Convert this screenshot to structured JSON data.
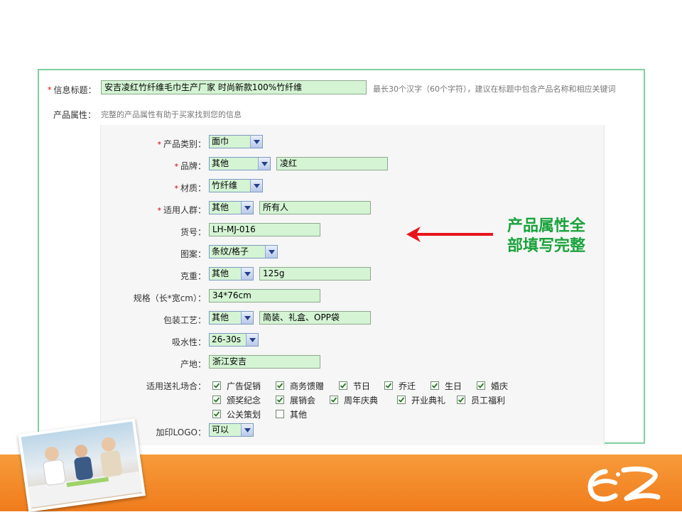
{
  "title_row": {
    "label": "信息标题：",
    "value": "安吉凌红竹纤维毛巾生产厂家 时尚新款100%竹纤维",
    "hint": "最长30个汉字（60个字符），建议在标题中包含产品名称和相应关键词"
  },
  "attr_row": {
    "label": "产品属性：",
    "hint": "完整的产品属性有助于买家找到您的信息"
  },
  "fields": {
    "category": {
      "label": "产品类别：",
      "value": "面巾"
    },
    "brand": {
      "label": "品牌：",
      "value": "其他",
      "extra": "凌红"
    },
    "material": {
      "label": "材质：",
      "value": "竹纤维"
    },
    "audience": {
      "label": "适用人群：",
      "value": "其他",
      "extra": "所有人"
    },
    "sku": {
      "label": "货号：",
      "value": "LH-MJ-016"
    },
    "pattern": {
      "label": "图案：",
      "value": "条纹/格子"
    },
    "weight": {
      "label": "克重：",
      "value": "其他",
      "extra": "125g"
    },
    "size": {
      "label": "规格（长*宽cm）：",
      "value": "34*76cm"
    },
    "packaging": {
      "label": "包装工艺：",
      "value": "其他",
      "extra": "简装、礼盒、OPP袋"
    },
    "absorbency": {
      "label": "吸水性：",
      "value": "26-30s"
    },
    "origin": {
      "label": "产地：",
      "value": "浙江安吉"
    },
    "occasions": {
      "label": "适用送礼场合：",
      "items": [
        {
          "label": "广告促销",
          "checked": true
        },
        {
          "label": "商务馈赠",
          "checked": true
        },
        {
          "label": "节日",
          "checked": true
        },
        {
          "label": "乔迁",
          "checked": true
        },
        {
          "label": "生日",
          "checked": true
        },
        {
          "label": "婚庆",
          "checked": true
        },
        {
          "label": "颁奖纪念",
          "checked": true
        },
        {
          "label": "展销会",
          "checked": true
        },
        {
          "label": "周年庆典",
          "checked": true
        },
        {
          "label": "开业典礼",
          "checked": true
        },
        {
          "label": "员工福利",
          "checked": true
        },
        {
          "label": "公关策划",
          "checked": true
        },
        {
          "label": "其他",
          "checked": false
        }
      ]
    },
    "logo_print": {
      "label": "加印LOGO：",
      "value": "可以"
    }
  },
  "required_mark": "*",
  "callout": {
    "line1": "产品属性全",
    "line2": "部填写完整",
    "color": "#1aa33c"
  },
  "colors": {
    "input_bg": "#d4f4d4",
    "panel_border": "#7fcfa0",
    "arrow": "#e8141b",
    "footer": "#f28a26"
  }
}
